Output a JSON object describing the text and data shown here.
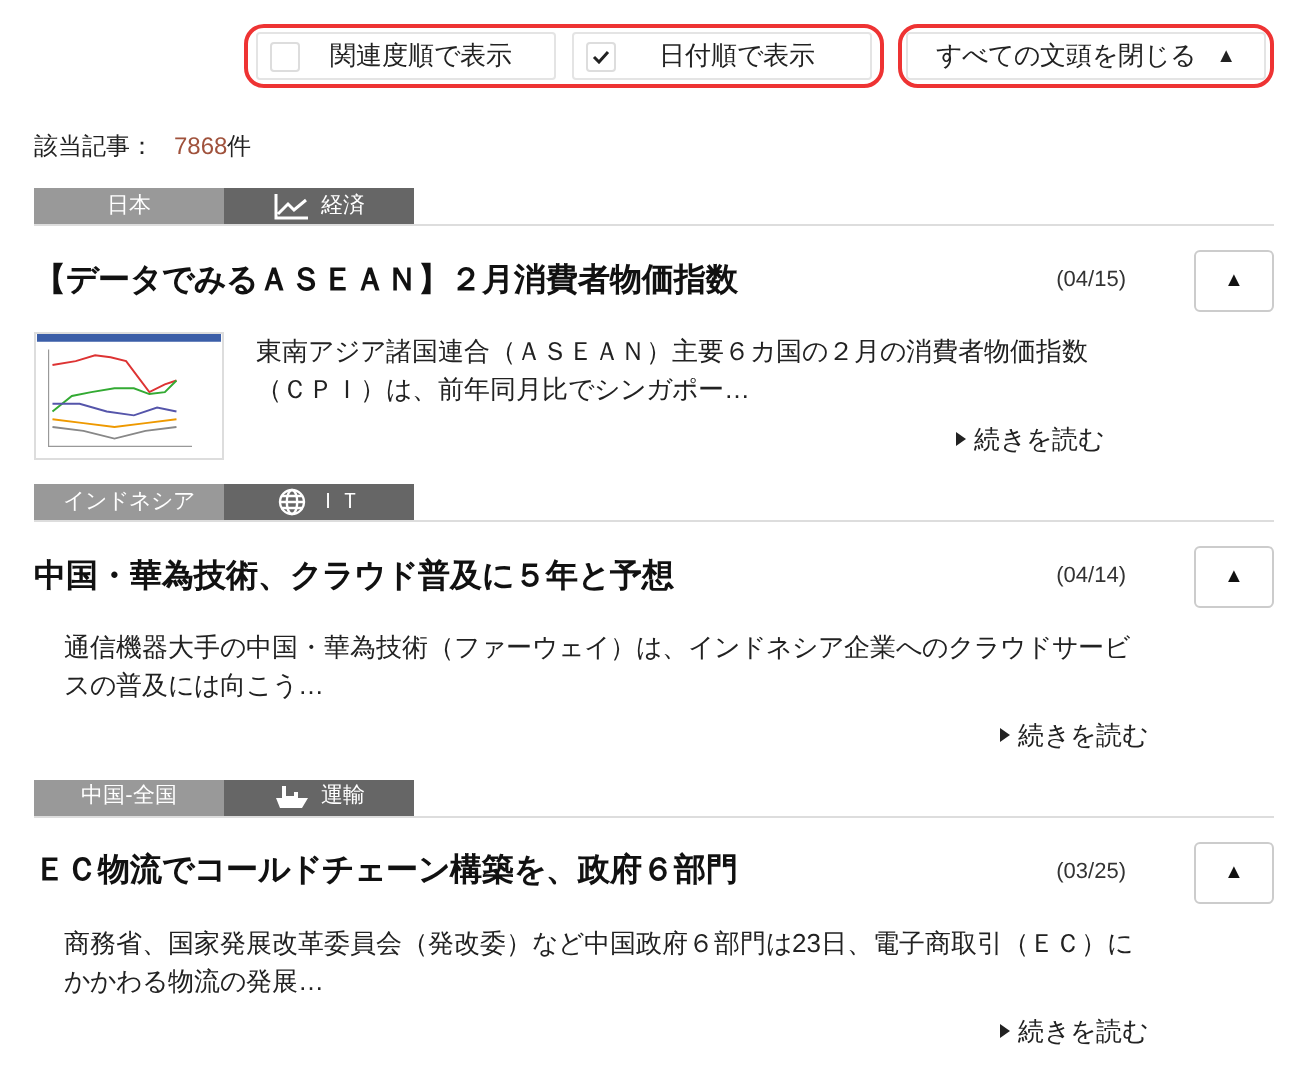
{
  "sort_options": [
    {
      "label": "関連度順で表示",
      "checked": false
    },
    {
      "label": "日付順で表示",
      "checked": true
    }
  ],
  "collapse_all": {
    "label": "すべての文頭を閉じる",
    "arrow": "▲"
  },
  "result_count": {
    "label": "該当記事：",
    "count": "7868",
    "unit": "件"
  },
  "articles": [
    {
      "region": "日本",
      "category": "経済",
      "kind": "chart",
      "title": "【データでみるＡＳＥＡＮ】２月消費者物価指数",
      "date": "(04/15)",
      "toggle": "▲",
      "thumbnail": true,
      "summary": "東南アジア諸国連合（ＡＳＥＡＮ）主要６カ国の２月の消費者物価指数（ＣＰＩ）は、前年同月比でシンガポー…",
      "read_more": "続きを読む"
    },
    {
      "region": "インドネシア",
      "category": "ＩＴ",
      "kind": "globe",
      "title": "中国・華為技術、クラウド普及に５年と予想",
      "date": "(04/14)",
      "toggle": "▲",
      "thumbnail": false,
      "summary": "通信機器大手の中国・華為技術（ファーウェイ）は、インドネシア企業へのクラウドサービスの普及には向こう…",
      "read_more": "続きを読む"
    },
    {
      "region": "中国-全国",
      "category": "運輸",
      "kind": "ship",
      "title": "ＥＣ物流でコールドチェーン構築を、政府６部門",
      "date": "(03/25)",
      "toggle": "▲",
      "thumbnail": false,
      "summary": "商務省、国家発展改革委員会（発改委）など中国政府６部門は23日、電子商取引（ＥＣ）にかかわる物流の発展…",
      "read_more": "続きを読む"
    }
  ]
}
